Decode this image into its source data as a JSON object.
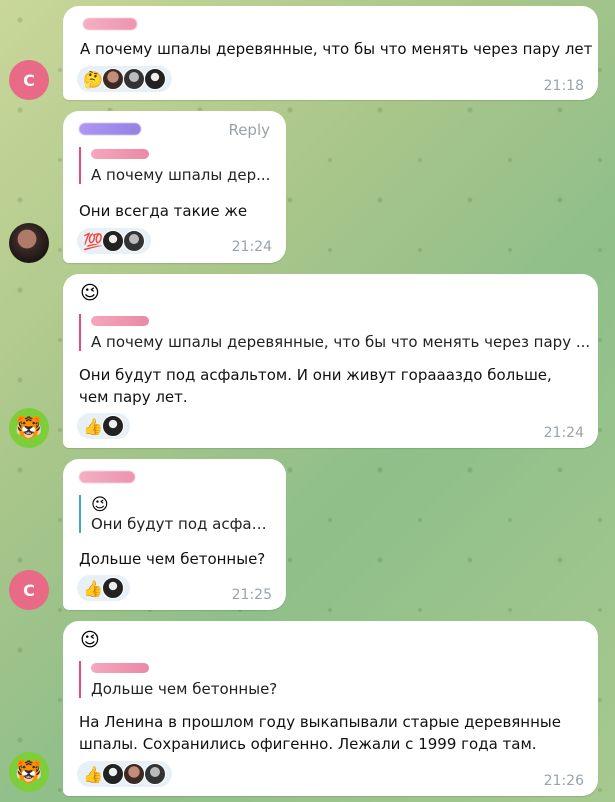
{
  "messages": [
    {
      "avatar": "С",
      "text": "А почему шпалы деревянные, что бы что менять через пару лет",
      "reaction": "🤔",
      "time": "21:18"
    },
    {
      "reply_label": "Reply",
      "quote": "А почему шпалы дер...",
      "text": "Они всегда такие же",
      "reaction": "💯",
      "time": "21:24"
    },
    {
      "top_emoji": "😉",
      "quote": "А почему шпалы деревянные, что бы что менять через пару ...",
      "text": "Они будут под асфальтом. И они живут горааазд﻿о больше, чем пару лет.",
      "reaction": "👍",
      "time": "21:24",
      "avatar": "🐯"
    },
    {
      "avatar": "С",
      "quote_emoji": "😉",
      "quote": "Они будут под асфал...",
      "text": "Дольше чем бетонные?",
      "reaction": "👍",
      "time": "21:25"
    },
    {
      "avatar": "🐯",
      "top_emoji": "😉",
      "quote": "Дольше чем бетонные?",
      "text": "На Ленина в прошлом году выкапывали старые деревянные шпалы. Сохранились офигенно. Лежали с 1999 года там.",
      "reaction": "👍",
      "time": "21:26"
    }
  ]
}
